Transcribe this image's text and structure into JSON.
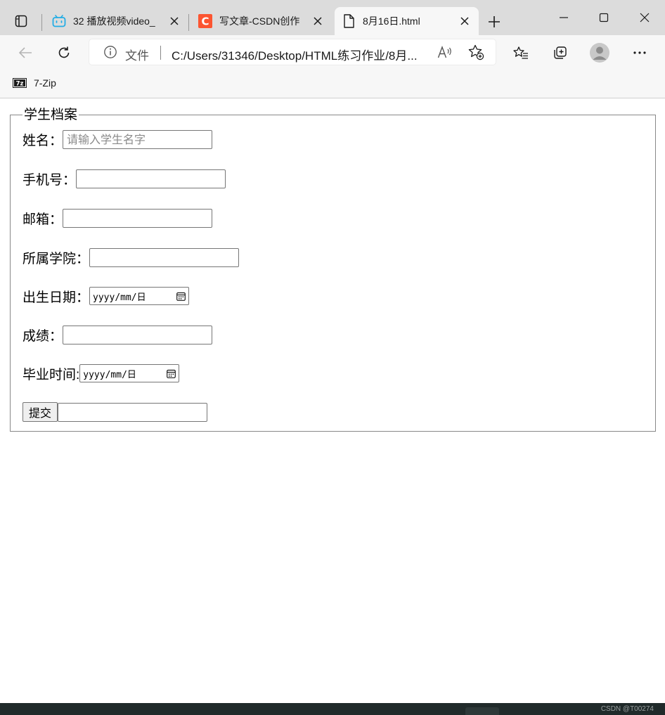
{
  "browser": {
    "tabs": [
      {
        "title": "32 播放视频video_",
        "favicon": "bilibili-icon",
        "active": false
      },
      {
        "title": "写文章-CSDN创作",
        "favicon": "csdn-icon",
        "active": false
      },
      {
        "title": "8月16日.html",
        "favicon": "file-icon",
        "active": true
      }
    ],
    "address": {
      "scheme_label": "文件",
      "url": "C:/Users/31346/Desktop/HTML练习作业/8月..."
    },
    "favorites": [
      {
        "label": "7-Zip",
        "icon": "7zip-icon"
      }
    ]
  },
  "form": {
    "legend": "学生档案",
    "fields": {
      "name": {
        "label": "姓名：",
        "placeholder": "请输入学生名字",
        "value": ""
      },
      "phone": {
        "label": "手机号：",
        "value": ""
      },
      "email": {
        "label": "邮箱：",
        "value": ""
      },
      "college": {
        "label": "所属学院：",
        "value": ""
      },
      "birthdate": {
        "label": "出生日期：",
        "value": "yyyy/mm/日"
      },
      "score": {
        "label": "成绩：",
        "value": ""
      },
      "graduation": {
        "label": "毕业时间:",
        "value": "yyyy/mm/日"
      }
    },
    "submit_label": "提交",
    "extra_input_value": ""
  },
  "watermark": "CSDN @T00274",
  "colors": {
    "tabstrip": "#dcdcdc",
    "toolbar": "#f7f7f7",
    "bilibili": "#23ade5",
    "csdn": "#fc5531"
  }
}
